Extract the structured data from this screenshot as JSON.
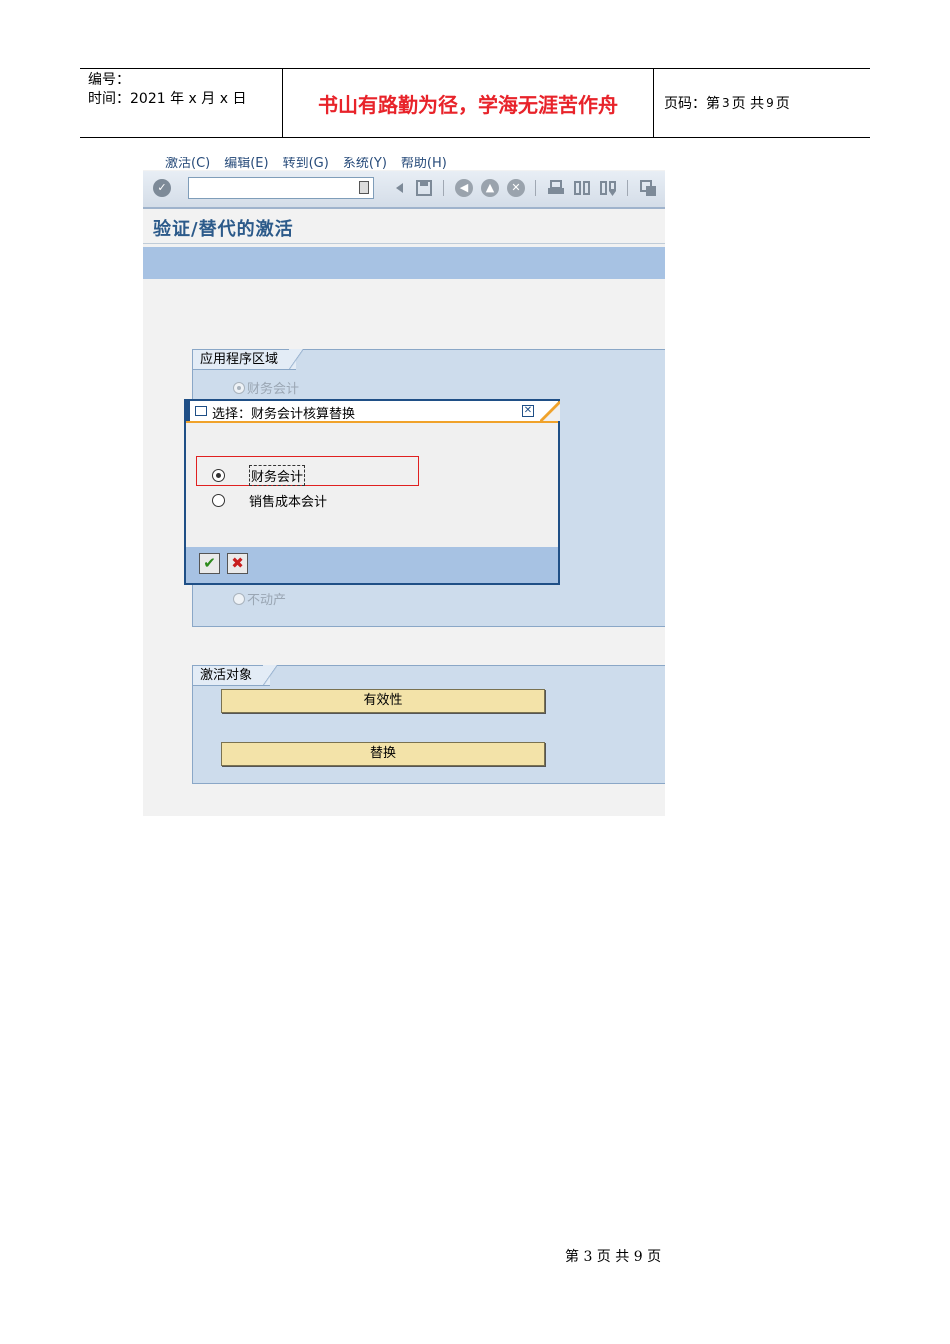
{
  "doc_header": {
    "number_label": "编号：",
    "time_label": "时间：2021 年 x 月 x 日",
    "motto": "书山有路勤为径，学海无涯苦作舟",
    "page_prefix": "页码：第",
    "page_current": "3",
    "page_mid": "页  共",
    "page_total": "9",
    "page_suffix": "页"
  },
  "sap": {
    "menu": [
      "激活(C)",
      "编辑(E)",
      "转到(G)",
      "系统(Y)",
      "帮助(H)"
    ],
    "command_field": {
      "value": "",
      "placeholder": ""
    },
    "icons": [
      "enter-icon",
      "back-icon",
      "save-icon",
      "back-arrow-icon",
      "exit-icon",
      "cancel-icon",
      "print-icon",
      "find-icon",
      "find-next-icon",
      "new-session-icon"
    ],
    "title": "验证/替代的激活",
    "application_area": {
      "label": "应用程序区域",
      "options": [
        "财务会计",
        "不动产"
      ]
    },
    "activation_object": {
      "label": "激活对象",
      "buttons": [
        "有效性",
        "替换"
      ]
    },
    "dialog": {
      "title": "选择：财务会计核算替换",
      "options": [
        {
          "label": "财务会计",
          "selected": true
        },
        {
          "label": "销售成本会计",
          "selected": false
        }
      ],
      "confirm_symbol": "✔",
      "cancel_symbol": "✖"
    }
  },
  "footer": {
    "page_text": "第 3 页 共 9 页"
  },
  "colors": {
    "motto": "#e8232a",
    "sap_blue_bar": "#a7c2e3",
    "group_bg": "#cddcec",
    "yellow_button": "#f3e3a9",
    "dialog_border": "#1f4f86",
    "highlight": "#e02020"
  }
}
